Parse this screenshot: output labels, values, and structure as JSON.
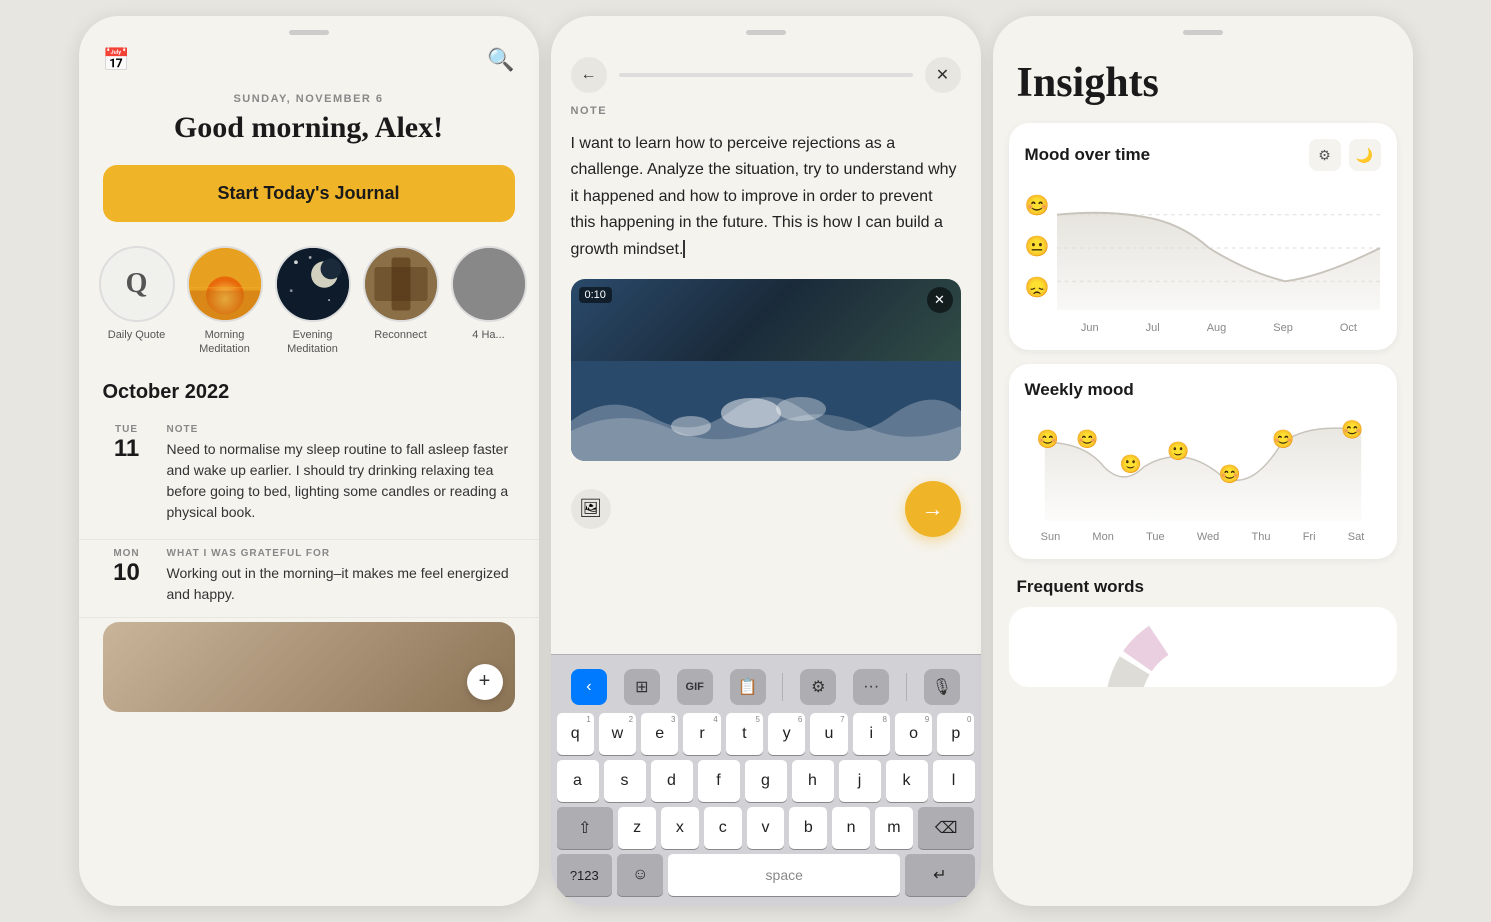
{
  "panel1": {
    "date": "SUNDAY, NOVEMBER 6",
    "greeting": "Good morning, Alex!",
    "start_journal_label": "Start Today's Journal",
    "circles": [
      {
        "label": "Daily Quote",
        "type": "daily-q",
        "symbol": "Q"
      },
      {
        "label": "Morning Meditation",
        "type": "morning"
      },
      {
        "label": "Evening Meditation",
        "type": "evening"
      },
      {
        "label": "Reconnect",
        "type": "reconnect"
      },
      {
        "label": "4 Ha...",
        "type": "extra"
      }
    ],
    "month_section": "October 2022",
    "entries": [
      {
        "day_name": "TUE",
        "day_num": "11",
        "type": "NOTE",
        "text": "Need to normalise my sleep routine to fall asleep faster and wake up earlier. I should try drinking relaxing tea before going to bed, lighting some candles or reading a physical book."
      },
      {
        "day_name": "MON",
        "day_num": "10",
        "type": "WHAT I WAS GRATEFUL FOR",
        "text": "Working out in the morning–it makes me feel energized and happy."
      }
    ],
    "add_label": "+"
  },
  "panel2": {
    "label": "NOTE",
    "note_text": "I want to learn how to perceive rejections as a challenge. Analyze the situation, try to understand why it happened and how to improve in order to prevent this happening in the future. This is how I can build a growth mindset.",
    "video_timer": "0:10",
    "keyboard": {
      "row1": [
        "q",
        "w",
        "e",
        "r",
        "t",
        "y",
        "u",
        "i",
        "o",
        "p"
      ],
      "row1_nums": [
        "1",
        "2",
        "3",
        "4",
        "5",
        "6",
        "7",
        "8",
        "9",
        "0"
      ],
      "row2": [
        "a",
        "s",
        "d",
        "f",
        "g",
        "h",
        "j",
        "k",
        "l"
      ],
      "row3": [
        "z",
        "x",
        "c",
        "v",
        "b",
        "n",
        "m"
      ],
      "space_label": "space",
      "num_sym_label": "?123",
      "return_label": "return"
    }
  },
  "panel3": {
    "title": "Insights",
    "mood_over_time": {
      "title": "Mood over time",
      "months": [
        "Jun",
        "Jul",
        "Aug",
        "Sep",
        "Oct"
      ],
      "emojis_left": [
        "😊",
        "😐",
        "😞"
      ]
    },
    "weekly_mood": {
      "title": "Weekly mood",
      "days": [
        "Sun",
        "Mon",
        "Tue",
        "Wed",
        "Thu",
        "Fri",
        "Sat"
      ]
    },
    "frequent_words": {
      "title": "Frequent words"
    }
  }
}
